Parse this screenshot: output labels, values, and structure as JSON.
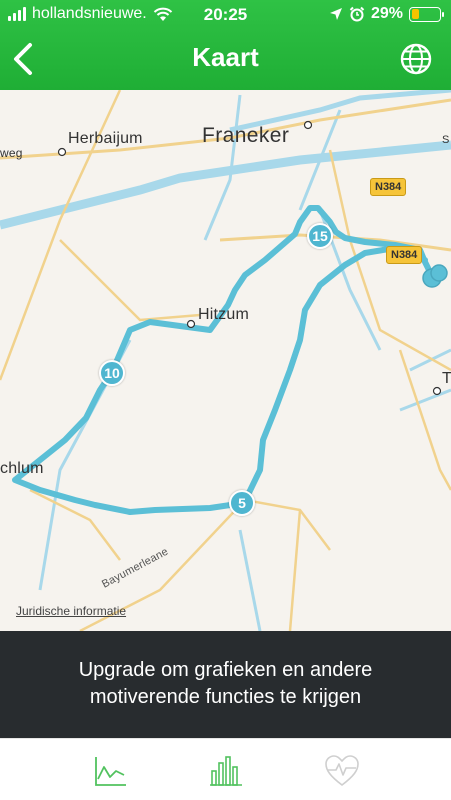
{
  "status_bar": {
    "carrier": "hollandsnieuwe.",
    "time": "20:25",
    "battery_percent": "29%",
    "battery_level": 0.29
  },
  "nav": {
    "title": "Kaart",
    "back_icon": "chevron-left-icon",
    "globe_icon": "globe-icon"
  },
  "map": {
    "places": {
      "herbaijum": "Herbaijum",
      "franeker": "Franeker",
      "hitzum": "Hitzum",
      "achlum": "chlum",
      "t_edge": "T",
      "s_edge": "S",
      "weg_edge": "weg"
    },
    "road_labels": {
      "n384_a": "N384",
      "n384_b": "N384",
      "bayumerleane": "Bayumerleane"
    },
    "km_markers": [
      "5",
      "10",
      "15"
    ],
    "legal": "Juridische informatie",
    "colors": {
      "route": "#5bbfd6",
      "water": "#a8d8ea",
      "road": "#f1d28d"
    }
  },
  "banner": {
    "line1": "Upgrade om grafieken en andere",
    "line2": "motiverende functies te krijgen"
  },
  "tabs": [
    {
      "icon": "line-chart-icon",
      "active": true
    },
    {
      "icon": "bar-chart-icon",
      "active": true
    },
    {
      "icon": "heart-rate-icon",
      "active": false
    }
  ]
}
